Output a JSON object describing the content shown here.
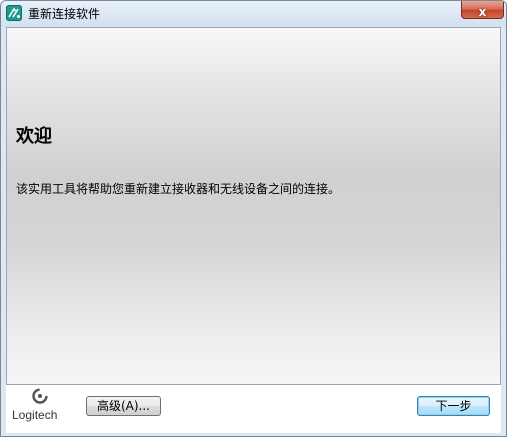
{
  "window": {
    "title": "重新连接软件",
    "close_glyph": "x",
    "icon": "app-reconnect-icon"
  },
  "content": {
    "heading": "欢迎",
    "description": "该实用工具将帮助您重新建立接收器和无线设备之间的连接。"
  },
  "footer": {
    "logo_text": "Logitech",
    "logo_icon": "logitech-logo-icon",
    "advanced_label": "高级(A)...",
    "next_label": "下一步"
  },
  "colors": {
    "titlebar": "#dce7f3",
    "close_button": "#c5452f",
    "default_button_border": "#3c7fb1"
  }
}
